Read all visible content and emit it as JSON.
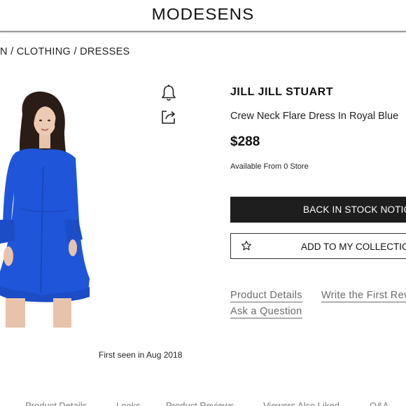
{
  "header": {
    "logo": "MODESENS"
  },
  "breadcrumb": {
    "item_women": "N",
    "sep1": " / ",
    "item_clothing": "CLOTHING",
    "sep2": " / ",
    "item_dresses": "DRESSES"
  },
  "product": {
    "image_alt": "Woman wearing royal blue flare dress",
    "brand": "JILL JILL STUART",
    "name": "Crew Neck Flare Dress In Royal Blue",
    "price": "$288",
    "availability": "Available From 0 Store",
    "first_seen": "First seen in Aug 2018",
    "dress_color": "#1f55d8"
  },
  "icons": {
    "alert": "bell-icon",
    "share": "share-icon",
    "favorite": "star-icon"
  },
  "actions": {
    "back_in_stock": "BACK IN STOCK NOTICE",
    "add_to_collection": "ADD TO MY COLLECTION"
  },
  "links": {
    "product_details": "Product Details",
    "write_review": "Write the First Review",
    "ask_question": "Ask a Question"
  },
  "bottom_nav": [
    "Product Details",
    "Looks",
    "Product Reviews",
    "Viewers Also Liked",
    "Q&A"
  ]
}
